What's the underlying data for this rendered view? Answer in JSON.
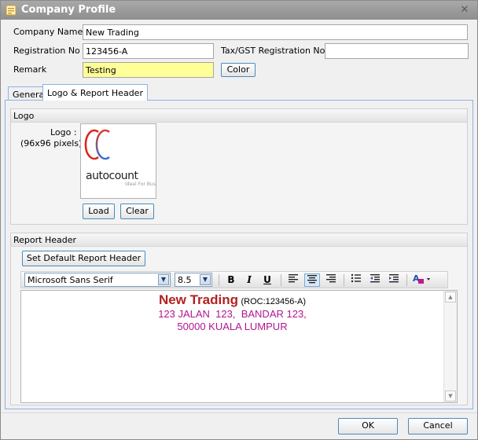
{
  "window": {
    "title": "Company Profile"
  },
  "form": {
    "company_name_label": "Company Name",
    "company_name_value": "New Trading",
    "registration_no_label": "Registration No",
    "registration_no_value": "123456-A",
    "tax_gst_label": "Tax/GST Registration No",
    "tax_gst_value": "",
    "remark_label": "Remark",
    "remark_value": "Testing",
    "color_button": "Color"
  },
  "tabs": [
    {
      "label": "General"
    },
    {
      "label": "Logo & Report Header"
    }
  ],
  "logo_group": {
    "header": "Logo",
    "logo_label": "Logo :",
    "logo_size_hint": "(96x96 pixels)",
    "load_button": "Load",
    "clear_button": "Clear"
  },
  "report_header_group": {
    "header": "Report Header",
    "set_default_button": "Set Default Report Header",
    "font_name": "Microsoft Sans Serif",
    "font_size": "8.5",
    "content": {
      "company_name": "New Trading",
      "roc": "(ROC:123456-A)",
      "address_line1": "123 JALAN  123,  BANDAR 123,",
      "address_line2": "50000 KUALA LUMPUR"
    }
  },
  "footer": {
    "ok_button": "OK",
    "cancel_button": "Cancel"
  },
  "colors": {
    "remark_highlight": "#ffff99",
    "header_company": "#b22222",
    "header_address": "#b0178f",
    "tab_border": "#8db2e3"
  }
}
